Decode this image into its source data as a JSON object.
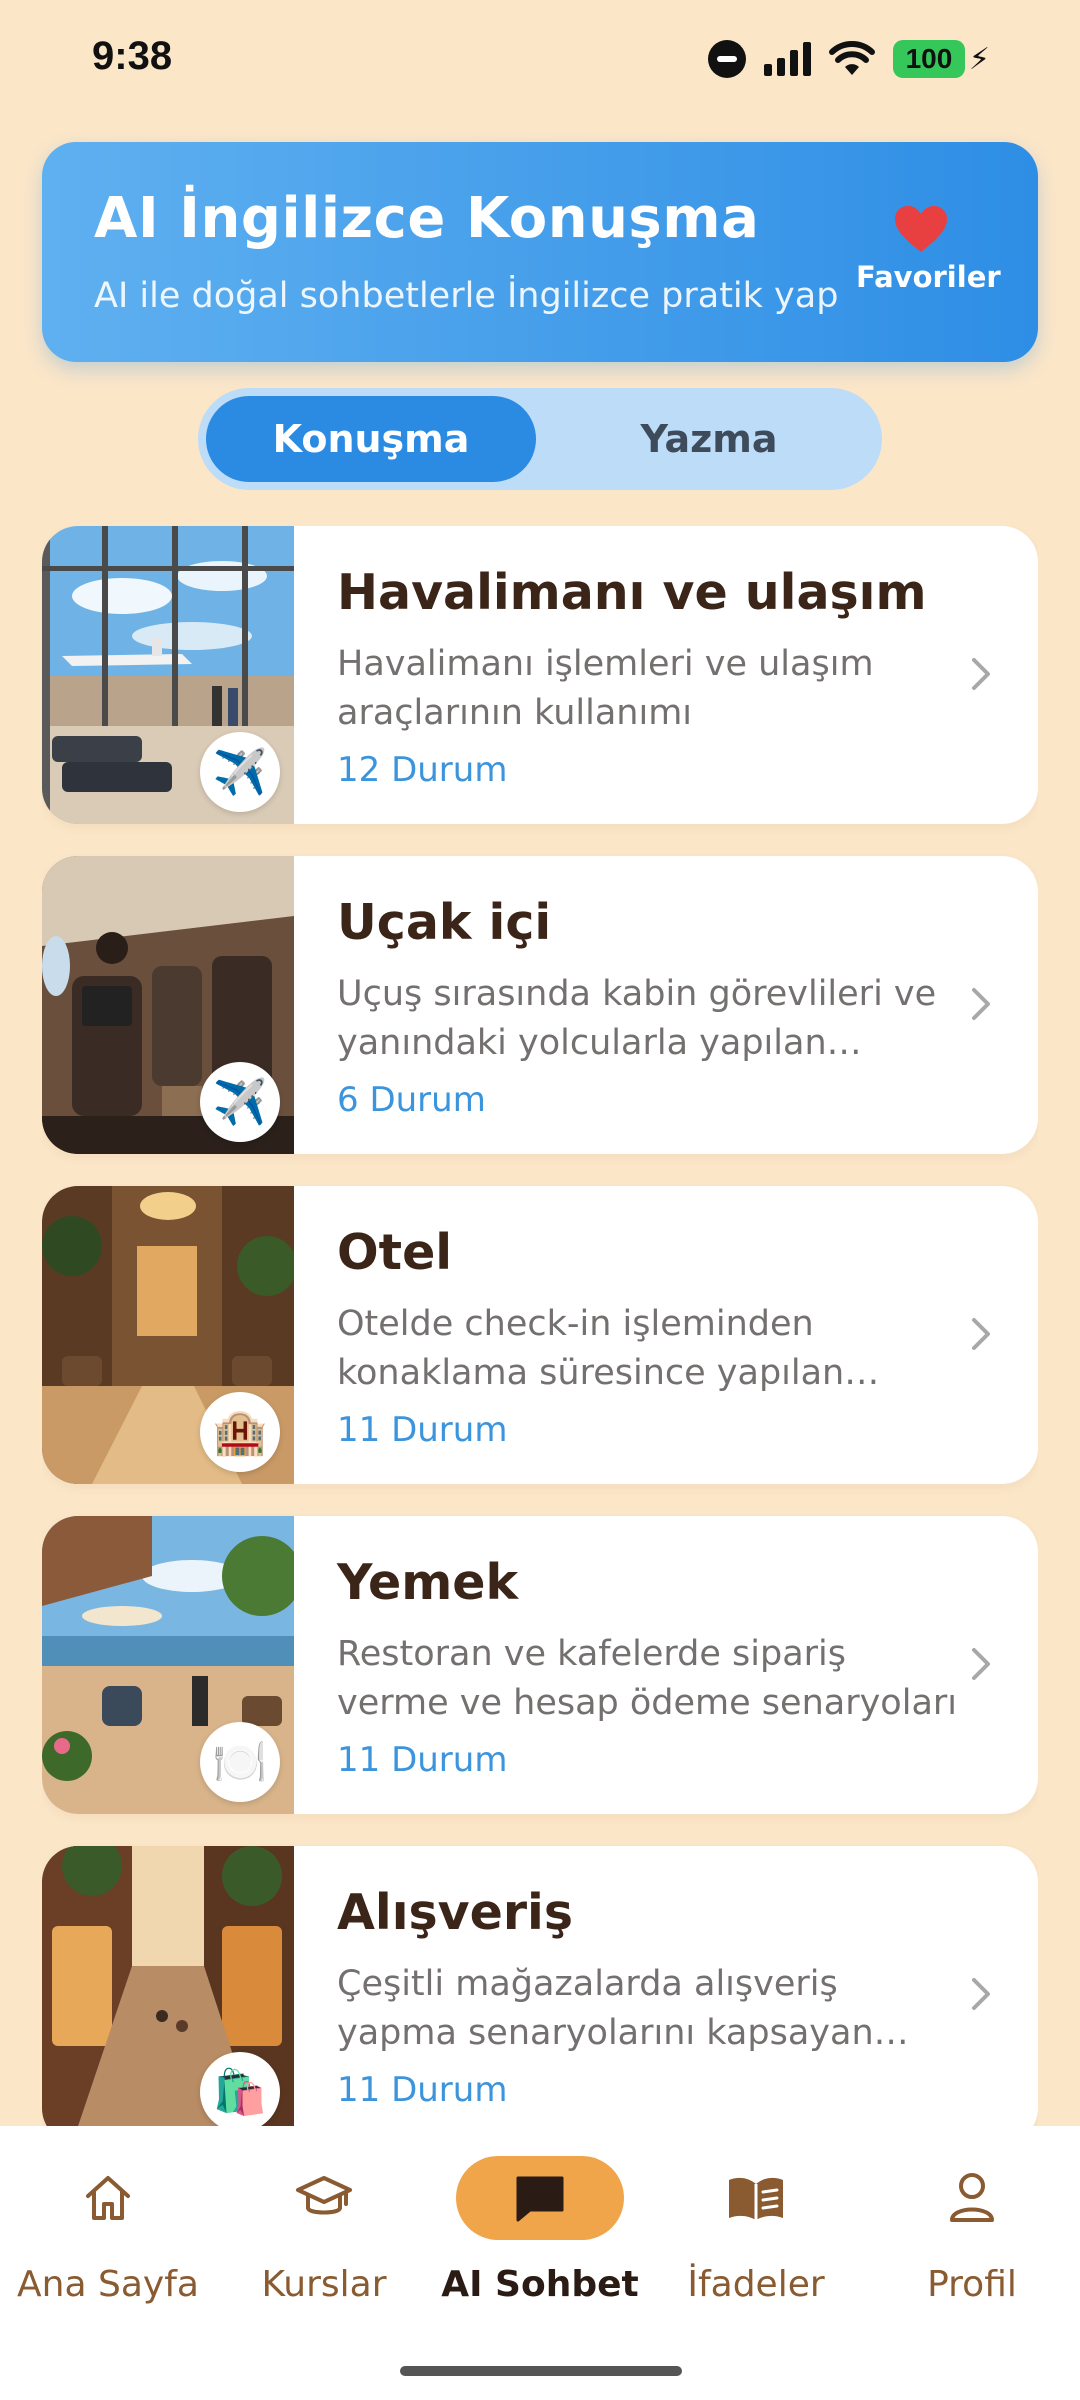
{
  "status_bar": {
    "time": "9:38",
    "battery": "100"
  },
  "header": {
    "title": "AI İngilizce Konuşma",
    "subtitle": "AI ile doğal sohbetlerle İngilizce pratik yap",
    "favorites_label": "Favoriler",
    "favorites_icon": "heart-icon"
  },
  "tabs": {
    "active": "Konuşma",
    "inactive": "Yazma"
  },
  "categories": [
    {
      "title": "Havalimanı ve ulaşım",
      "description": "Havalimanı işlemleri ve ulaşım araçlarının kullanımı",
      "count": "12 Durum",
      "badge": "✈️"
    },
    {
      "title": "Uçak içi",
      "description": "Uçuş sırasında kabin görevlileri ve yanındaki yolcularla yapılan konuşmalar",
      "count": "6 Durum",
      "badge": "✈️"
    },
    {
      "title": "Otel",
      "description": "Otelde check-in işleminden konaklama süresince yapılan konuşmalar",
      "count": "11 Durum",
      "badge": "🏨"
    },
    {
      "title": "Yemek",
      "description": "Restoran ve kafelerde sipariş verme ve hesap ödeme senaryoları",
      "count": "11 Durum",
      "badge": "🍽️"
    },
    {
      "title": "Alışveriş",
      "description": "Çeşitli mağazalarda alışveriş yapma senaryolarını kapsayan konuşmalar",
      "count": "11 Durum",
      "badge": "🛍️"
    }
  ],
  "nav": [
    {
      "label": "Ana Sayfa",
      "icon": "home-icon"
    },
    {
      "label": "Kurslar",
      "icon": "graduation-cap-icon"
    },
    {
      "label": "AI Sohbet",
      "icon": "chat-icon",
      "active": true
    },
    {
      "label": "İfadeler",
      "icon": "book-icon"
    },
    {
      "label": "Profil",
      "icon": "person-icon"
    }
  ],
  "colors": {
    "background": "#fbe6c8",
    "accent_blue": "#2b8ae2",
    "nav_active": "#f0a54a",
    "heart": "#e84040"
  }
}
